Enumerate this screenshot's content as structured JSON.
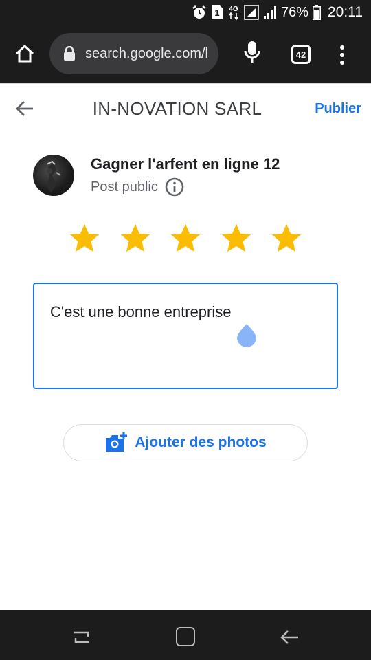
{
  "status_bar": {
    "network": "4G",
    "sim_badge": "1",
    "battery": "76%",
    "time": "20:11",
    "icons": [
      "alarm-icon",
      "sim-icon",
      "signal-icon",
      "wifi-signal-icon",
      "battery-icon"
    ]
  },
  "browser": {
    "url": "search.google.com/l",
    "tab_count": "42",
    "icons": [
      "home-icon",
      "lock-icon",
      "mic-icon",
      "tabs-icon",
      "overflow-menu-icon"
    ]
  },
  "header": {
    "title": "IN-NOVATION SARL",
    "publish_label": "Publier"
  },
  "author": {
    "name": "Gagner l'arfent en ligne 12",
    "visibility": "Post public"
  },
  "rating": {
    "value": 5,
    "max": 5,
    "color": "#fbbc04"
  },
  "review": {
    "text": "C'est une bonne entreprise"
  },
  "actions": {
    "add_photos_label": "Ajouter des photos"
  },
  "colors": {
    "accent": "#1a73e8",
    "star": "#fbbc04",
    "chrome_dark": "#1c1c1c"
  }
}
